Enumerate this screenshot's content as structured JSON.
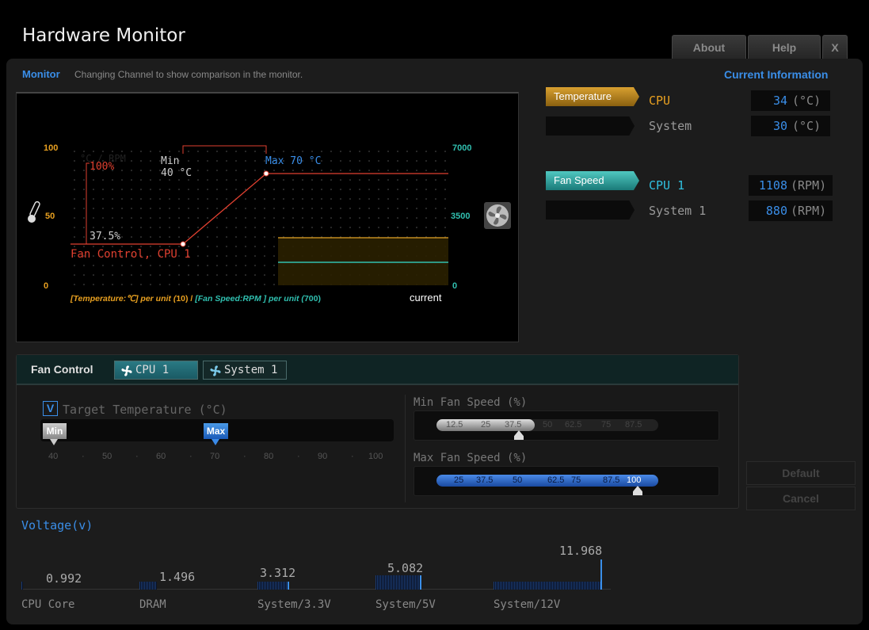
{
  "app": {
    "title": "Hardware Monitor",
    "buttons": {
      "about": "About",
      "help": "Help",
      "close": "X"
    }
  },
  "monitor": {
    "title": "Monitor",
    "description": "Changing Channel to show comparison in the monitor.",
    "graph": {
      "y_left_top": "100",
      "y_left_mid": "50",
      "y_left_bottom": "0",
      "y_right_top": "7000",
      "y_right_mid": "3500",
      "y_right_bottom": "0",
      "unit_overlay": "°C / RPM",
      "pct_100": "100%",
      "pct_37": "37.5%",
      "min_label": "Min",
      "min_temp": "40 °C",
      "max_label": "Max 70 °C",
      "series_label": "Fan Control, CPU 1",
      "legend_temp": "[Temperature:℃] per unit (",
      "legend_temp_val": "10",
      "legend_sep": ") / ",
      "legend_fan": "[Fan Speed:RPM ] per unit (",
      "legend_fan_val": "700",
      "legend_close": ")",
      "current_label": "current"
    },
    "icons": {
      "left": "thermometer-icon",
      "right": "fan-icon"
    }
  },
  "current_info": {
    "title": "Current Information",
    "temperature_tag": "Temperature",
    "fan_speed_tag": "Fan Speed",
    "temperatures": [
      {
        "name": "CPU",
        "value": "34",
        "unit": "(°C)"
      },
      {
        "name": "System",
        "value": "30",
        "unit": "(°C)"
      }
    ],
    "fans": [
      {
        "name": "CPU 1",
        "value": "1108",
        "unit": "(RPM)"
      },
      {
        "name": "System 1",
        "value": "880",
        "unit": "(RPM)"
      }
    ]
  },
  "fan_control": {
    "title": "Fan Control",
    "tabs": [
      {
        "label": "CPU 1",
        "active": true
      },
      {
        "label": "System 1",
        "active": false
      }
    ],
    "target_temp": {
      "checkbox": "V",
      "checked": true,
      "label": "Target Temperature (°C)",
      "min_handle": "Min",
      "max_handle": "Max",
      "min_value": 40,
      "max_value": 70,
      "scale": [
        "40",
        "50",
        "60",
        "70",
        "80",
        "90",
        "100"
      ]
    },
    "min_fan": {
      "label": "Min Fan Speed (%)",
      "options": [
        "12.5",
        "25",
        "37.5",
        "50",
        "62.5",
        "75",
        "87.5"
      ],
      "selected": "37.5"
    },
    "max_fan": {
      "label": "Max Fan Speed (%)",
      "options": [
        "25",
        "37.5",
        "50",
        "62.5",
        "75",
        "87.5",
        "100"
      ],
      "selected": "100"
    },
    "buttons": {
      "default": "Default",
      "cancel": "Cancel"
    }
  },
  "voltage": {
    "title": "Voltage(v)",
    "items": [
      {
        "name": "CPU Core",
        "value": "0.992"
      },
      {
        "name": "DRAM",
        "value": "1.496"
      },
      {
        "name": "System/3.3V",
        "value": "3.312"
      },
      {
        "name": "System/5V",
        "value": "5.082"
      },
      {
        "name": "System/12V",
        "value": "11.968"
      }
    ]
  },
  "colors": {
    "accent_blue": "#3a8ee8",
    "temp_orange": "#e8a020",
    "fan_teal": "#30c0b0",
    "curve_red": "#e04030"
  }
}
